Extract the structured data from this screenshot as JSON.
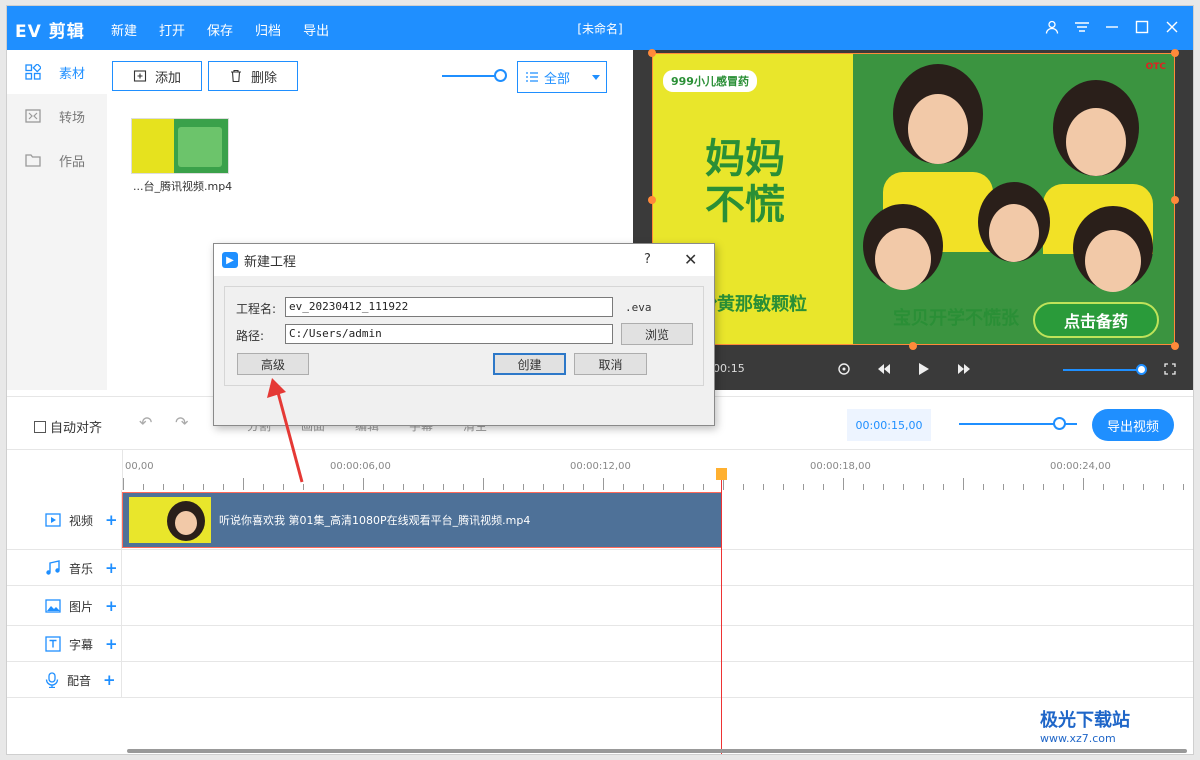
{
  "app": {
    "brand": "EV 剪辑",
    "doc_title": "[未命名]"
  },
  "menu": [
    "新建",
    "打开",
    "保存",
    "归档",
    "导出"
  ],
  "window_controls": [
    "user-icon",
    "menu-icon",
    "minimize-icon",
    "maximize-icon",
    "close-icon"
  ],
  "sidenav": [
    {
      "label": "素材",
      "icon": "grid-icon"
    },
    {
      "label": "转场",
      "icon": "transition-icon"
    },
    {
      "label": "作品",
      "icon": "folder-icon"
    }
  ],
  "materials": {
    "add_label": "添加",
    "delete_label": "删除",
    "filter_value": "全部",
    "item_label": "...台_腾讯视频.mp4"
  },
  "preview": {
    "logo": "999小儿感冒药",
    "slogan_line1": "妈妈",
    "slogan_line2": "不慌",
    "drug_name": "氨酚黄那敏颗粒",
    "banner": "宝贝开学不慌张",
    "cta": "点击备药",
    "otc": "OTC",
    "time": "00:15"
  },
  "tools": {
    "auto_align": "自动对齐",
    "timecode": "00:00:15,00",
    "export_label": "导出视频",
    "hidden": [
      "分割",
      "画面",
      "编辑",
      "字幕",
      "清空"
    ]
  },
  "ruler": [
    "00,00",
    "00:00:06,00",
    "00:00:12,00",
    "00:00:18,00",
    "00:00:24,00"
  ],
  "tracks": [
    {
      "label": "视频",
      "icon": "video-icon"
    },
    {
      "label": "音乐",
      "icon": "music-icon"
    },
    {
      "label": "图片",
      "icon": "image-icon"
    },
    {
      "label": "字幕",
      "icon": "text-icon"
    },
    {
      "label": "配音",
      "icon": "mic-icon"
    }
  ],
  "clip": {
    "title": "听说你喜欢我 第01集_高清1080P在线观看平台_腾讯视频.mp4"
  },
  "dialog": {
    "title": "新建工程",
    "help": "?",
    "name_label": "工程名:",
    "name_value": "ev_20230412_111922",
    "ext": ".eva",
    "path_label": "路径:",
    "path_value": "C:/Users/admin",
    "browse": "浏览",
    "advanced": "高级",
    "create": "创建",
    "cancel": "取消"
  },
  "watermark": {
    "name": "极光下载站",
    "url": "www.xz7.com"
  },
  "colors": {
    "accent": "#1f8fff",
    "clip": "#4e7198",
    "annotation": "#e53935"
  }
}
